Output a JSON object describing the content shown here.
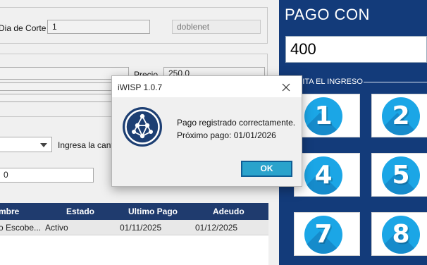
{
  "form": {
    "dia_corte_label": "Dia de Corte",
    "dia_corte_value": "1",
    "router_value": "doblenet",
    "precio_label": "Precio",
    "precio_value": "250.0",
    "combo_value": "",
    "ingresa_label": "Ingresa la cant",
    "amount_field_value": "0"
  },
  "table": {
    "columns": [
      "mbre",
      "Estado",
      "Ultimo Pago",
      "Adeudo"
    ],
    "rows": [
      [
        "o Escobe...",
        "Activo",
        "01/11/2025",
        "01/12/2025"
      ]
    ]
  },
  "payment_panel": {
    "title": "PAGO CON",
    "amount_value": "400",
    "hint": "SITA EL INGRESO",
    "keys": [
      "1",
      "2",
      "4",
      "5",
      "7",
      "8"
    ],
    "accent_color": "#1ba6e6",
    "panel_color": "#133b7a"
  },
  "dialog": {
    "title": "iWISP 1.0.7",
    "message_line1": "Pago registrado correctamente.",
    "message_line2": "Próximo pago: 01/01/2026",
    "ok_label": "OK",
    "icon": "network-logo-icon",
    "close_icon": "close-icon"
  }
}
